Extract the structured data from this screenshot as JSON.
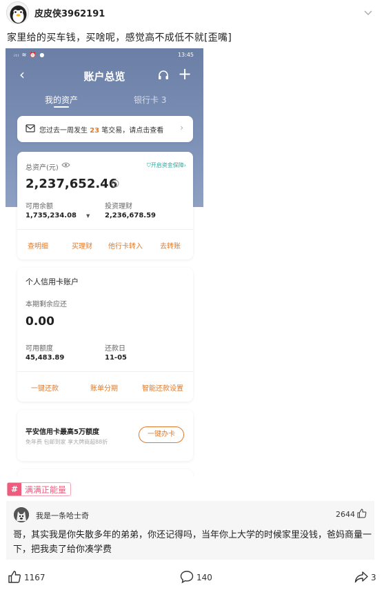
{
  "post": {
    "username": "皮皮侠3962191",
    "text": "家里给的买车钱，买啥呢，感觉高不成低不就[歪嘴]"
  },
  "phone": {
    "status_left": "ᵢₜₗ ≋ ⏰ ●",
    "status_time": "13:45",
    "nav_title": "账户总览",
    "tabs": [
      "我的资产",
      "银行卡 3"
    ],
    "notice": {
      "prefix": "您过去一周发生 ",
      "count": "23",
      "suffix": " 笔交易，请点击查看"
    },
    "assets": {
      "total_label": "总资产(元)",
      "protect_link": "开启资金保障",
      "total_value": "2,237,652.46",
      "available_label": "可用余额",
      "available_value": "1,735,234.08",
      "invest_label": "投资理财",
      "invest_value": "2,236,678.59",
      "actions": [
        "查明细",
        "买理财",
        "他行卡转入",
        "去转账"
      ]
    },
    "credit": {
      "title": "个人信用卡账户",
      "due_label": "本期剩余应还",
      "due_value": "0.00",
      "limit_label": "可用额度",
      "limit_value": "45,483.89",
      "repay_label": "还款日",
      "repay_value": "11-05",
      "actions": [
        "一键还款",
        "账单分期",
        "智能还款设置"
      ]
    },
    "promo": {
      "title": "平安信用卡最高5万额度",
      "subtitle": "免年费 包邮到家 享大牌商超88折",
      "button": "一键办卡"
    }
  },
  "tag": {
    "icon": "#",
    "text": "满满正能量"
  },
  "comment": {
    "username": "我是一条哈士奇",
    "likes": "2644",
    "text": "哥，其实我是你失散多年的弟弟，你还记得吗，当年你上大学的时候家里没钱，爸妈商量一下，把我卖了给你凑学费"
  },
  "bar": {
    "likes": "1167",
    "comments": "140",
    "shares": "3"
  },
  "colors": {
    "accent_orange": "#e07a2b",
    "header_blue": "#7e92b8",
    "tag_pink": "#ef5a7d",
    "protect_green": "#2aa89a"
  }
}
